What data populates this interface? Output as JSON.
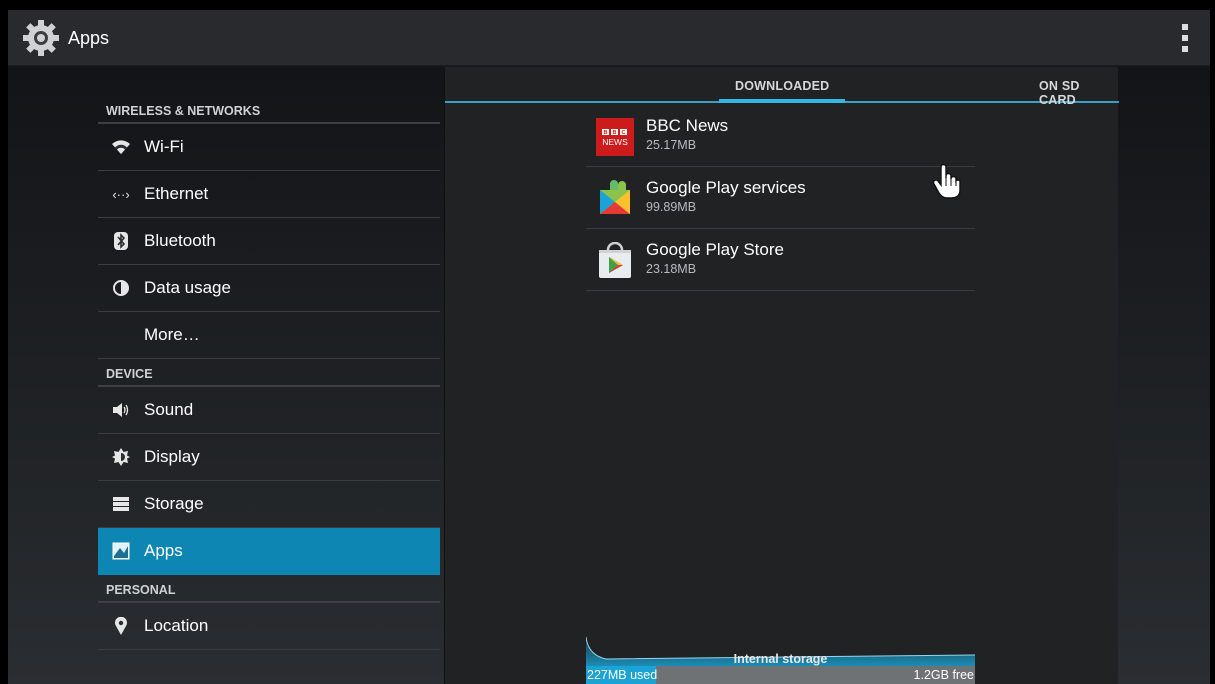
{
  "actionbar": {
    "title": "Apps",
    "icon": "settings-gear-icon",
    "menu_icon": "overflow-menu-icon"
  },
  "sidebar": {
    "sections": [
      {
        "header": "WIRELESS & NETWORKS",
        "items": [
          {
            "label": "Wi-Fi",
            "icon": "wifi-icon"
          },
          {
            "label": "Ethernet",
            "icon": "ethernet-icon"
          },
          {
            "label": "Bluetooth",
            "icon": "bluetooth-icon"
          },
          {
            "label": "Data usage",
            "icon": "data-usage-icon"
          },
          {
            "label": "More…",
            "icon": ""
          }
        ]
      },
      {
        "header": "DEVICE",
        "items": [
          {
            "label": "Sound",
            "icon": "sound-icon"
          },
          {
            "label": "Display",
            "icon": "display-icon"
          },
          {
            "label": "Storage",
            "icon": "storage-icon"
          },
          {
            "label": "Apps",
            "icon": "apps-icon",
            "selected": true
          }
        ]
      },
      {
        "header": "PERSONAL",
        "items": [
          {
            "label": "Location",
            "icon": "location-icon"
          }
        ]
      }
    ]
  },
  "tabs": {
    "downloaded": "DOWNLOADED",
    "sdcard": "ON SD CARD",
    "active": "downloaded"
  },
  "apps": [
    {
      "name": "BBC News",
      "size": "25.17MB",
      "icon": "bbc-news-icon",
      "icon_text_top": "BBC",
      "icon_text_bottom": "NEWS"
    },
    {
      "name": "Google Play services",
      "size": "99.89MB",
      "icon": "play-services-icon"
    },
    {
      "name": "Google Play Store",
      "size": "23.18MB",
      "icon": "play-store-icon"
    }
  ],
  "storage": {
    "label": "Internal storage",
    "used": "227MB used",
    "free": "1.2GB free",
    "used_fraction": 0.18
  },
  "colors": {
    "accent": "#33b5e5",
    "selected": "#0d86b4",
    "bbc_red": "#d0021b"
  }
}
